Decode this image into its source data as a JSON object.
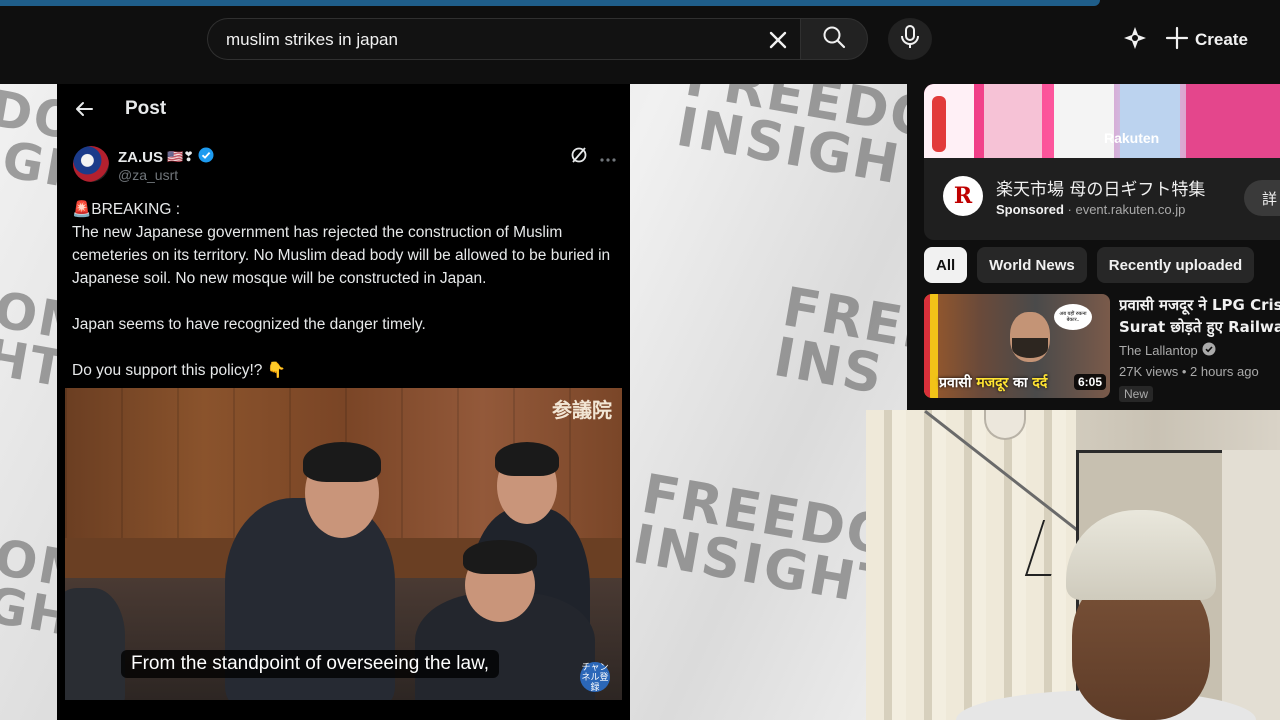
{
  "header": {
    "search_query": "muslim strikes in japan",
    "create_label": "Create",
    "icons": [
      "clear-icon",
      "search-icon",
      "mic-icon",
      "sparkle-icon",
      "plus-icon"
    ]
  },
  "video": {
    "watermark_word1": "FREEDOM",
    "watermark_word2": "INSIGHT",
    "watermark_l_left_1": "DOI",
    "watermark_l_left_2": "IGH",
    "watermark_l_mid_1": "OM",
    "watermark_l_mid_2": "HT",
    "watermark_l_low_1": "OM",
    "watermark_l_low_2": "GHT",
    "watermark_r_top_1": "FREEDO",
    "watermark_r_top_2": "INSIGH",
    "watermark_r_mid_1": "FREE",
    "watermark_r_mid_2": "INS",
    "watermark_r_low_1": "FREEDOM",
    "watermark_r_low_2": "INSIGHT"
  },
  "tweet": {
    "page_title": "Post",
    "username": "ZA.US",
    "username_emoji": "🇺🇸❣",
    "handle": "@za_usrt",
    "line_breaking": "🚨BREAKING :",
    "body_1": "The new Japanese government has rejected the construction of Muslim cemeteries on its territory. No Muslim dead body will be allowed to be buried in Japanese soil. No new mosque will be constructed in Japan.",
    "body_2": "Japan seems to have recognized the danger timely.",
    "body_3": "Do you support this policy!? 👇",
    "media_kanji": "参議院",
    "media_caption": "From the standpoint of overseeing the law,",
    "media_badge": "チャンネル登録"
  },
  "sidebar": {
    "ad": {
      "title": "楽天市場 母の日ギフト特集",
      "sponsored_label": "Sponsored",
      "domain": "event.rakuten.co.jp",
      "banner_brand": "Rakuten",
      "logo_letter": "R",
      "cta": "詳"
    },
    "chips": [
      "All",
      "World News",
      "Recently uploaded"
    ],
    "rec": {
      "title_1": "प्रवासी मजदूर ने LPG Crisis",
      "title_2": "Surat छोड़ते हुए Railway S",
      "channel": "The Lallantop",
      "stats": "27K views • 2 hours ago",
      "badge": "New",
      "duration": "6:05",
      "thumb_text_a": "प्रवासी ",
      "thumb_text_b": "मजदूर",
      "thumb_text_c": " का ",
      "thumb_text_d": "दर्द",
      "thumb_bubble": "अब यहीं रुकना बेकार.."
    }
  },
  "colors": {
    "background": "#0f0f0f",
    "chip_active": "#f1f1f1",
    "chip": "#272727",
    "accent_blue": "#1d9bf0"
  }
}
